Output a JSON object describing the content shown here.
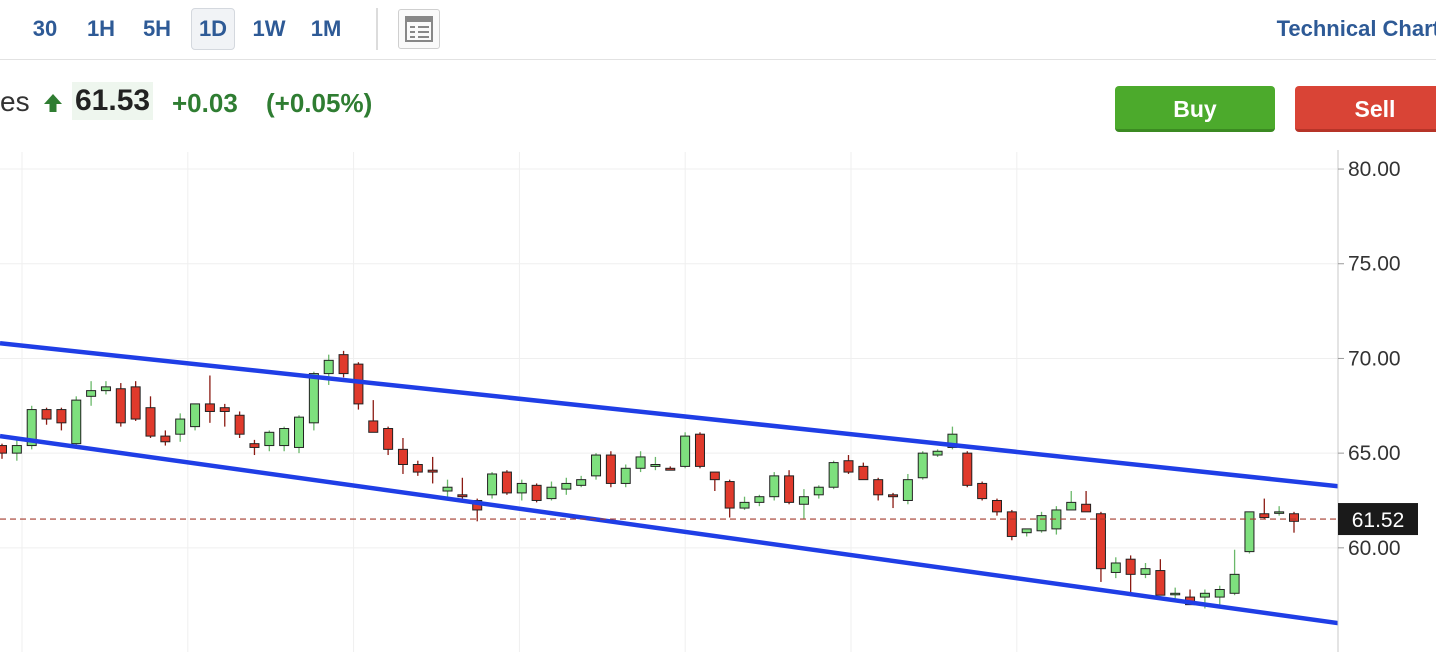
{
  "toolbar": {
    "timeframes": [
      {
        "label": "30",
        "active": false
      },
      {
        "label": "1H",
        "active": false
      },
      {
        "label": "5H",
        "active": false
      },
      {
        "label": "1D",
        "active": true
      },
      {
        "label": "1W",
        "active": false
      },
      {
        "label": "1M",
        "active": false
      }
    ],
    "layout_icon": "layout-icon",
    "technical_chart_label": "Technical Chart"
  },
  "quote": {
    "name_fragment": "es",
    "direction_icon": "up-arrow-icon",
    "last": "61.53",
    "change": "+0.03",
    "change_pct": "(+0.05%)",
    "up_color": "#2f7d32"
  },
  "actions": {
    "buy_label": "Buy",
    "sell_label": "Sell",
    "buy_color": "#4caa2c",
    "sell_color": "#d94436"
  },
  "chart_data": {
    "type": "candlestick",
    "ylim": [
      54.5,
      80.9
    ],
    "yticks": [
      "80.00",
      "75.00",
      "70.00",
      "65.00",
      "60.00"
    ],
    "grid": true,
    "last_price_label": "61.52",
    "last_price": 61.52,
    "up_color": "#7ee07e",
    "down_color": "#e03a2c",
    "channel_color": "#1f3ee6",
    "candles": [
      [
        65.4,
        65.5,
        64.7,
        65.0
      ],
      [
        65.0,
        65.7,
        64.6,
        65.4
      ],
      [
        65.4,
        67.5,
        65.2,
        67.3
      ],
      [
        67.3,
        67.4,
        66.5,
        66.8
      ],
      [
        67.3,
        67.4,
        66.2,
        66.6
      ],
      [
        65.5,
        68.0,
        65.3,
        67.8
      ],
      [
        68.0,
        68.8,
        67.5,
        68.3
      ],
      [
        68.3,
        68.8,
        68.1,
        68.5
      ],
      [
        68.4,
        68.7,
        66.4,
        66.6
      ],
      [
        68.5,
        68.8,
        66.7,
        66.8
      ],
      [
        67.4,
        68.0,
        65.8,
        65.9
      ],
      [
        65.9,
        66.2,
        65.4,
        65.6
      ],
      [
        66.0,
        67.1,
        65.6,
        66.8
      ],
      [
        66.4,
        67.6,
        66.2,
        67.6
      ],
      [
        67.6,
        69.1,
        66.6,
        67.2
      ],
      [
        67.4,
        67.6,
        66.4,
        67.2
      ],
      [
        67.0,
        67.2,
        65.8,
        66.0
      ],
      [
        65.5,
        65.7,
        64.9,
        65.3
      ],
      [
        65.4,
        66.2,
        65.1,
        66.1
      ],
      [
        65.4,
        66.4,
        65.1,
        66.3
      ],
      [
        65.3,
        67.0,
        65.0,
        66.9
      ],
      [
        66.6,
        69.3,
        66.2,
        69.2
      ],
      [
        69.2,
        70.2,
        68.6,
        69.9
      ],
      [
        70.2,
        70.4,
        69.0,
        69.2
      ],
      [
        69.7,
        69.8,
        67.3,
        67.6
      ],
      [
        66.7,
        67.8,
        66.3,
        66.1
      ],
      [
        66.3,
        66.4,
        64.9,
        65.2
      ],
      [
        65.2,
        65.8,
        63.9,
        64.4
      ],
      [
        64.4,
        64.6,
        63.8,
        64.0
      ],
      [
        64.1,
        64.8,
        63.4,
        64.0
      ],
      [
        63.0,
        63.6,
        62.6,
        63.2
      ],
      [
        62.8,
        63.7,
        62.4,
        62.7
      ],
      [
        62.5,
        62.6,
        61.4,
        62.0
      ],
      [
        62.8,
        64.0,
        62.6,
        63.9
      ],
      [
        64.0,
        64.1,
        62.8,
        62.9
      ],
      [
        62.9,
        63.6,
        62.5,
        63.4
      ],
      [
        63.3,
        63.4,
        62.4,
        62.5
      ],
      [
        62.6,
        63.5,
        62.5,
        63.2
      ],
      [
        63.1,
        63.7,
        62.8,
        63.4
      ],
      [
        63.3,
        63.8,
        63.2,
        63.6
      ],
      [
        63.8,
        65.0,
        63.6,
        64.9
      ],
      [
        64.9,
        65.1,
        63.2,
        63.4
      ],
      [
        63.4,
        64.4,
        63.2,
        64.2
      ],
      [
        64.2,
        65.1,
        64.0,
        64.8
      ],
      [
        64.3,
        64.8,
        64.1,
        64.4
      ],
      [
        64.2,
        64.3,
        64.1,
        64.1
      ],
      [
        64.3,
        66.1,
        64.2,
        65.9
      ],
      [
        66.0,
        66.1,
        64.2,
        64.3
      ],
      [
        64.0,
        64.0,
        63.0,
        63.6
      ],
      [
        63.5,
        63.6,
        61.6,
        62.1
      ],
      [
        62.1,
        62.7,
        62.0,
        62.4
      ],
      [
        62.4,
        62.8,
        62.2,
        62.7
      ],
      [
        62.7,
        64.0,
        62.5,
        63.8
      ],
      [
        63.8,
        64.1,
        62.3,
        62.4
      ],
      [
        62.3,
        63.1,
        61.5,
        62.7
      ],
      [
        62.8,
        63.3,
        62.6,
        63.2
      ],
      [
        63.2,
        64.6,
        63.1,
        64.5
      ],
      [
        64.6,
        64.9,
        63.9,
        64.0
      ],
      [
        64.3,
        64.5,
        63.6,
        63.6
      ],
      [
        63.6,
        63.7,
        62.5,
        62.8
      ],
      [
        62.8,
        62.9,
        62.1,
        62.7
      ],
      [
        62.5,
        63.9,
        62.3,
        63.6
      ],
      [
        63.7,
        65.1,
        63.6,
        65.0
      ],
      [
        64.9,
        65.2,
        64.8,
        65.1
      ],
      [
        65.3,
        66.4,
        65.2,
        66.0
      ],
      [
        65.0,
        65.1,
        63.2,
        63.3
      ],
      [
        63.4,
        63.5,
        62.5,
        62.6
      ],
      [
        62.5,
        62.6,
        61.7,
        61.9
      ],
      [
        61.9,
        62.0,
        60.4,
        60.6
      ],
      [
        60.8,
        61.0,
        60.6,
        61.0
      ],
      [
        60.9,
        61.9,
        60.8,
        61.7
      ],
      [
        61.0,
        62.2,
        60.7,
        62.0
      ],
      [
        62.0,
        63.0,
        62.0,
        62.4
      ],
      [
        62.3,
        63.0,
        62.0,
        61.9
      ],
      [
        61.8,
        61.9,
        58.2,
        58.9
      ],
      [
        58.7,
        59.5,
        58.4,
        59.2
      ],
      [
        59.4,
        59.6,
        57.6,
        58.6
      ],
      [
        58.6,
        59.2,
        58.4,
        58.9
      ],
      [
        58.8,
        59.4,
        57.6,
        57.5
      ],
      [
        57.6,
        57.9,
        57.2,
        57.6
      ],
      [
        57.4,
        57.8,
        57.0,
        57.0
      ],
      [
        57.4,
        57.8,
        56.8,
        57.6
      ],
      [
        57.4,
        58.0,
        56.9,
        57.8
      ],
      [
        57.6,
        59.9,
        57.5,
        58.6
      ],
      [
        59.8,
        61.9,
        59.7,
        61.9
      ],
      [
        61.8,
        62.6,
        61.5,
        61.6
      ],
      [
        61.9,
        62.2,
        61.7,
        61.9
      ],
      [
        61.8,
        61.9,
        60.8,
        61.4
      ]
    ],
    "channel_upper": [
      [
        70.8,
        69.9
      ],
      [
        62.7,
        62.1
      ]
    ],
    "channel_lower": [
      [
        65.9,
        57.0
      ],
      [
        55.3,
        55.6
      ]
    ]
  }
}
